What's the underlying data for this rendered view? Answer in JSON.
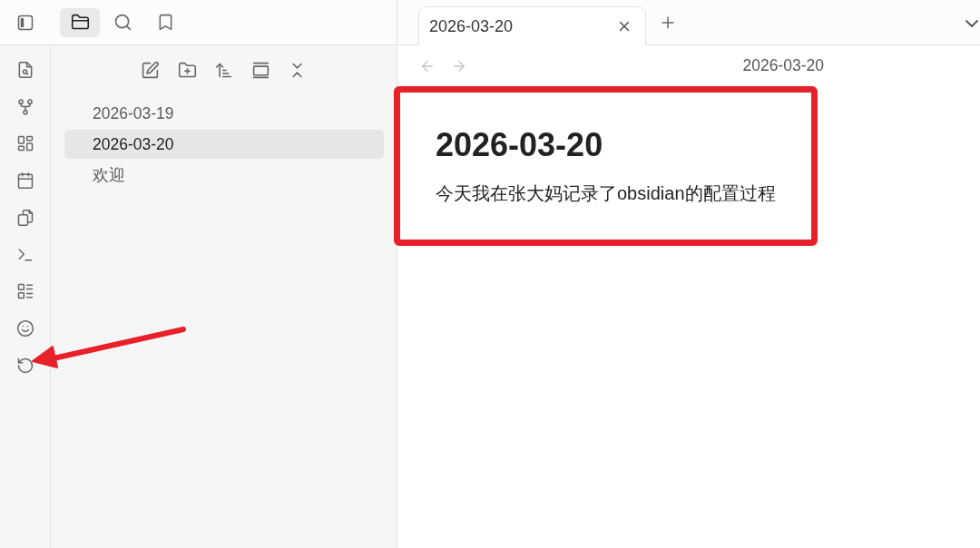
{
  "sidebar_tabs": [
    {
      "selected": true
    },
    {
      "selected": false
    },
    {
      "selected": false
    }
  ],
  "file_explorer": {
    "items": [
      {
        "name": "2026-03-19",
        "selected": false
      },
      {
        "name": "2026-03-20",
        "selected": true
      },
      {
        "name": "欢迎",
        "selected": false
      }
    ]
  },
  "tabs": [
    {
      "title": "2026-03-20",
      "selected": true
    }
  ],
  "nav_buttons": [
    {
      "disabled": true
    },
    {
      "disabled": true
    }
  ],
  "view_header": {
    "title": "2026-03-20"
  },
  "note": {
    "heading": "2026-03-20",
    "body": "今天我在张大妈记录了obsidian的配置过程"
  }
}
